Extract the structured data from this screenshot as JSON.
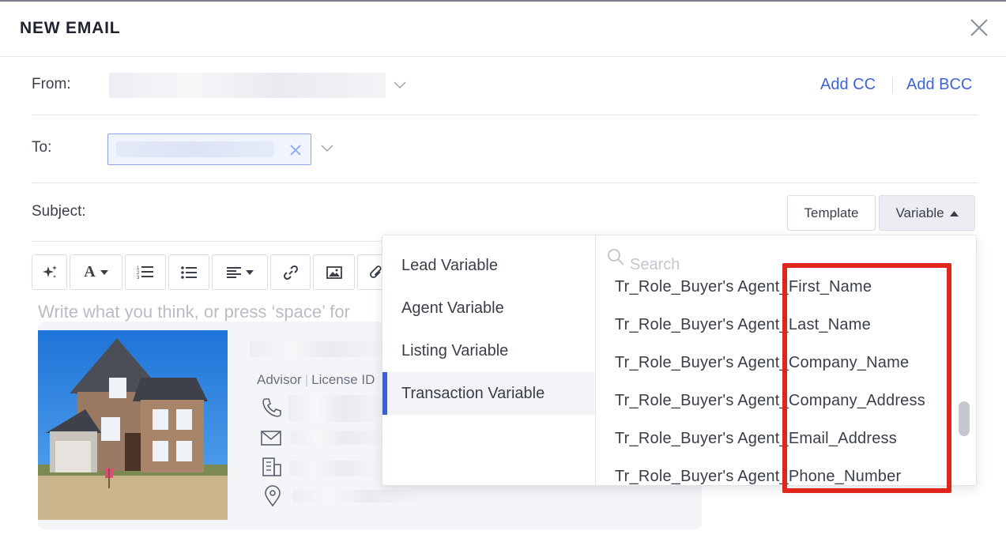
{
  "dialog": {
    "title": "NEW EMAIL",
    "close_icon": "close-icon"
  },
  "from": {
    "label": "From:"
  },
  "cc": {
    "add_cc": "Add CC",
    "add_bcc": "Add BCC",
    "separator": "|"
  },
  "to": {
    "label": "To:"
  },
  "subject": {
    "label": "Subject:",
    "template_button": "Template",
    "variable_button": "Variable"
  },
  "toolbar": {
    "icons": [
      "ai-sparkle-icon",
      "font-icon",
      "ordered-list-icon",
      "bullet-list-icon",
      "align-icon",
      "link-icon",
      "image-icon",
      "attachment-icon"
    ]
  },
  "editor": {
    "placeholder": "Write what you think, or press ‘space’ for"
  },
  "signature": {
    "role": "Advisor",
    "separator": "|",
    "license": "License ID"
  },
  "variable_menu": {
    "categories": [
      {
        "label": "Lead Variable",
        "active": false
      },
      {
        "label": "Agent Variable",
        "active": false
      },
      {
        "label": "Listing Variable",
        "active": false
      },
      {
        "label": "Transaction Variable",
        "active": true
      }
    ],
    "search_placeholder": "Search",
    "items": [
      "Tr_Role_Buyer's Agent_First_Name",
      "Tr_Role_Buyer's Agent_Last_Name",
      "Tr_Role_Buyer's Agent_Company_Name",
      "Tr_Role_Buyer's Agent_Company_Address",
      "Tr_Role_Buyer's Agent_Email_Address",
      "Tr_Role_Buyer's Agent_Phone_Number"
    ]
  },
  "colors": {
    "accent": "#3d63d8",
    "active_bar": "#3d5fd6",
    "highlight": "#e0251b"
  }
}
